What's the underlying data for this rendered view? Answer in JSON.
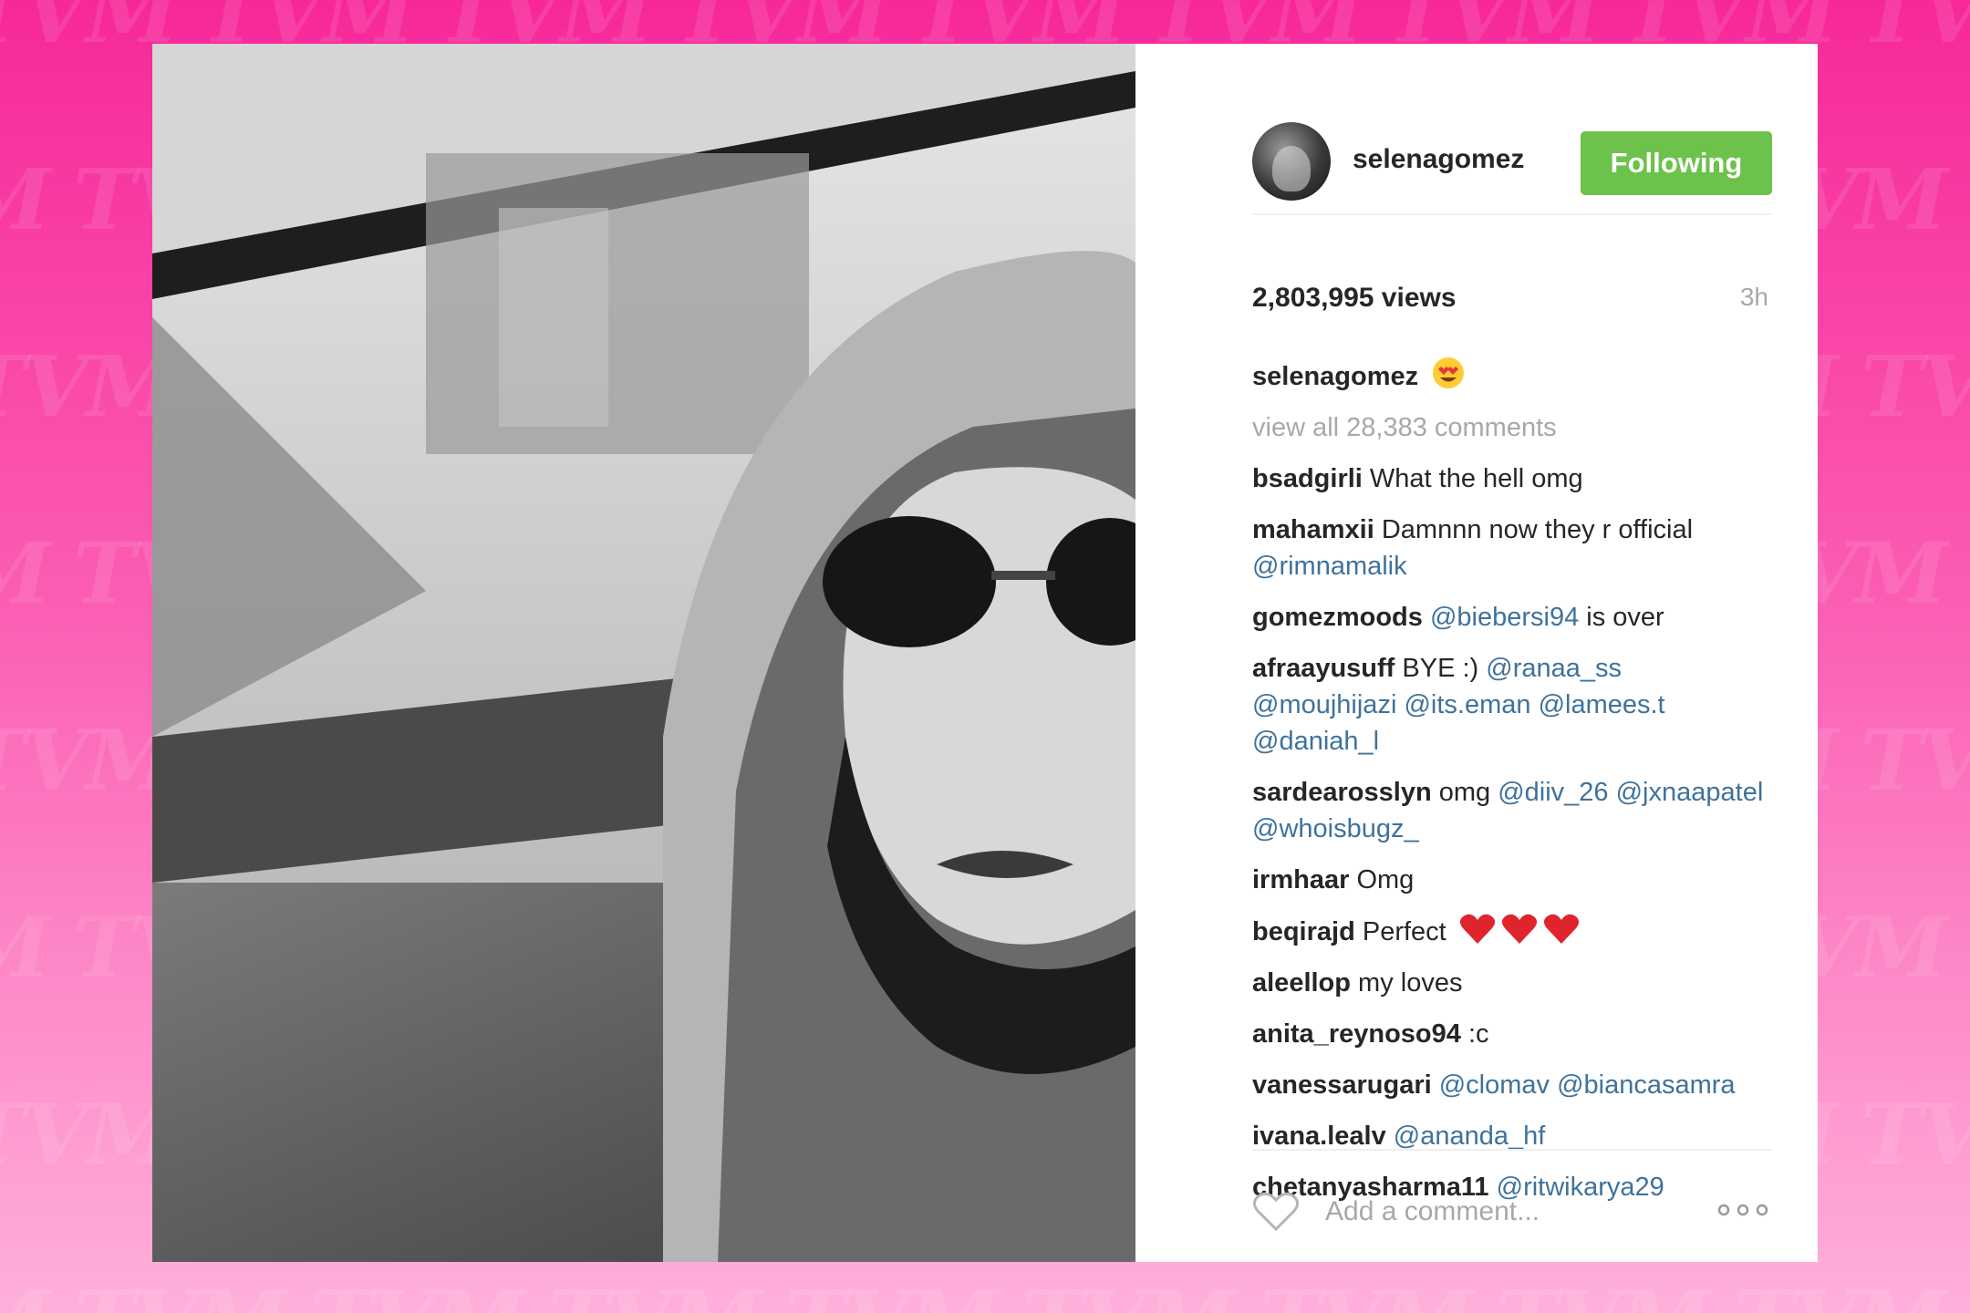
{
  "background": {
    "watermark_text": "TVM",
    "gradient_top": "#f7289a",
    "gradient_bottom": "#ffb0da"
  },
  "post": {
    "photo_icon": "black-and-white-selfie-photo",
    "author": "selenagomez",
    "follow_label": "Following",
    "follow_color": "#6cc24a",
    "views": "2,803,995 views",
    "time_ago": "3h",
    "caption": {
      "user": "selenagomez",
      "emoji": "heart-eyes-emoji"
    },
    "view_all_comments": "view all 28,383 comments",
    "comments": [
      {
        "user": "bsadgirli",
        "segments": [
          {
            "text": " What the hell omg",
            "mention": false
          }
        ]
      },
      {
        "user": "mahamxii",
        "segments": [
          {
            "text": " Damnnn now they r official ",
            "mention": false
          },
          {
            "text": "@rimnamalik",
            "mention": true
          }
        ]
      },
      {
        "user": "gomezmoods",
        "segments": [
          {
            "text": " ",
            "mention": false
          },
          {
            "text": "@biebersi94",
            "mention": true
          },
          {
            "text": " is over",
            "mention": false
          }
        ]
      },
      {
        "user": "afraayusuff",
        "segments": [
          {
            "text": " BYE :) ",
            "mention": false
          },
          {
            "text": "@ranaa_ss",
            "mention": true
          },
          {
            "text": " ",
            "mention": false
          },
          {
            "text": "@moujhijazi",
            "mention": true
          },
          {
            "text": " ",
            "mention": false
          },
          {
            "text": "@its.eman",
            "mention": true
          },
          {
            "text": " ",
            "mention": false
          },
          {
            "text": "@lamees.t",
            "mention": true
          },
          {
            "text": " ",
            "mention": false
          },
          {
            "text": "@daniah_l",
            "mention": true
          }
        ]
      },
      {
        "user": "sardearosslyn",
        "segments": [
          {
            "text": " omg ",
            "mention": false
          },
          {
            "text": "@diiv_26",
            "mention": true
          },
          {
            "text": " ",
            "mention": false
          },
          {
            "text": "@jxnaapatel",
            "mention": true
          },
          {
            "text": " ",
            "mention": false
          },
          {
            "text": "@whoisbugz_",
            "mention": true
          }
        ]
      },
      {
        "user": "irmhaar",
        "segments": [
          {
            "text": " Omg",
            "mention": false
          }
        ]
      },
      {
        "user": "beqirajd",
        "segments": [
          {
            "text": " Perfect ",
            "mention": false
          }
        ],
        "hearts": 3
      },
      {
        "user": "aleellop",
        "segments": [
          {
            "text": " my loves",
            "mention": false
          }
        ]
      },
      {
        "user": "anita_reynoso94",
        "segments": [
          {
            "text": " :c",
            "mention": false
          }
        ]
      },
      {
        "user": "vanessarugari",
        "segments": [
          {
            "text": " ",
            "mention": false
          },
          {
            "text": "@clomav",
            "mention": true
          },
          {
            "text": " ",
            "mention": false
          },
          {
            "text": "@biancasamra",
            "mention": true
          }
        ]
      },
      {
        "user": "ivana.lealv",
        "segments": [
          {
            "text": " ",
            "mention": false
          },
          {
            "text": "@ananda_hf",
            "mention": true
          }
        ]
      },
      {
        "user": "chetanyasharma11",
        "segments": [
          {
            "text": " ",
            "mention": false
          },
          {
            "text": "@ritwikarya29",
            "mention": true
          }
        ]
      }
    ],
    "mention_color": "#3f729b",
    "add_comment_placeholder": "Add a comment...",
    "like_icon": "heart-outline-icon",
    "more_icon": "more-options-icon"
  }
}
